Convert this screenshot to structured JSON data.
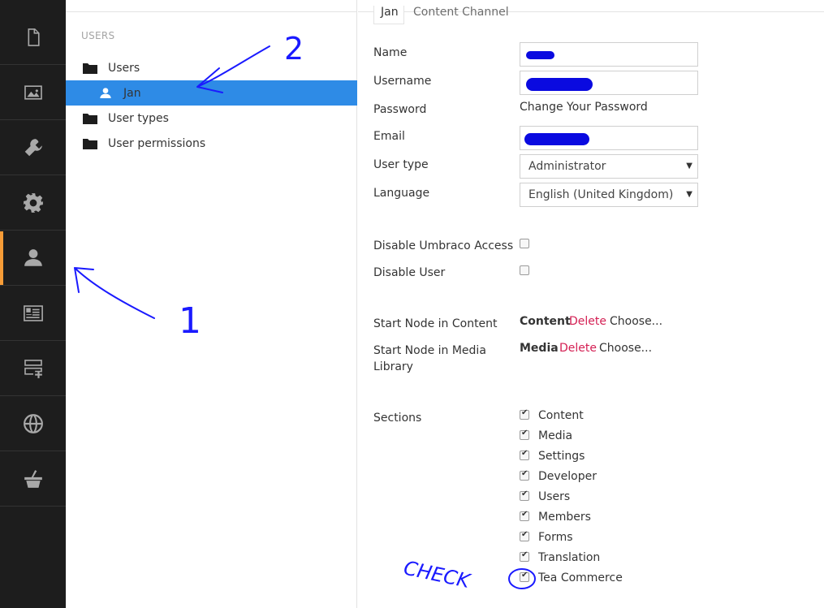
{
  "appbar": {
    "items": [
      {
        "icon": "document-icon",
        "name": "content-section"
      },
      {
        "icon": "image-icon",
        "name": "media-section"
      },
      {
        "icon": "wrench-icon",
        "name": "settings-section"
      },
      {
        "icon": "gear-icon",
        "name": "developer-section"
      },
      {
        "icon": "user-icon",
        "name": "users-section",
        "active": true
      },
      {
        "icon": "id-card-icon",
        "name": "members-section"
      },
      {
        "icon": "forms-icon",
        "name": "forms-section"
      },
      {
        "icon": "globe-icon",
        "name": "translation-section"
      },
      {
        "icon": "basket-icon",
        "name": "tea-commerce-section"
      }
    ],
    "accent": "#f79c37"
  },
  "tree": {
    "heading": "USERS",
    "nodes": [
      {
        "label": "Users"
      },
      {
        "label": "Jan",
        "selected": true
      },
      {
        "label": "User types"
      },
      {
        "label": "User permissions"
      }
    ],
    "selected_color": "#2e8be6"
  },
  "editor": {
    "tabs": [
      "Jan",
      "Content Channel"
    ],
    "labels": {
      "name": "Name",
      "username": "Username",
      "password": "Password",
      "email": "Email",
      "user_type": "User type",
      "language": "Language",
      "disable_umbraco_access": "Disable Umbraco Access",
      "disable_user": "Disable User",
      "start_node_content": "Start Node in Content",
      "start_node_media_1": "Start Node in Media",
      "start_node_media_2": "Library",
      "sections": "Sections"
    },
    "password_link": "Change Your Password",
    "user_type_value": "Administrator",
    "language_value": "English (United Kingdom)",
    "start_content": {
      "node": "Content",
      "delete": "Delete",
      "choose": "Choose..."
    },
    "start_media": {
      "node": "Media",
      "delete": "Delete",
      "choose": "Choose..."
    },
    "sections": [
      {
        "label": "Content",
        "checked": true
      },
      {
        "label": "Media",
        "checked": true
      },
      {
        "label": "Settings",
        "checked": true
      },
      {
        "label": "Developer",
        "checked": true
      },
      {
        "label": "Users",
        "checked": true
      },
      {
        "label": "Members",
        "checked": true
      },
      {
        "label": "Forms",
        "checked": true
      },
      {
        "label": "Translation",
        "checked": true
      },
      {
        "label": "Tea Commerce",
        "checked": true
      }
    ]
  },
  "annotations": {
    "numbers": [
      "1",
      "2"
    ],
    "note": "CHECK",
    "color": "#1a1aff"
  }
}
